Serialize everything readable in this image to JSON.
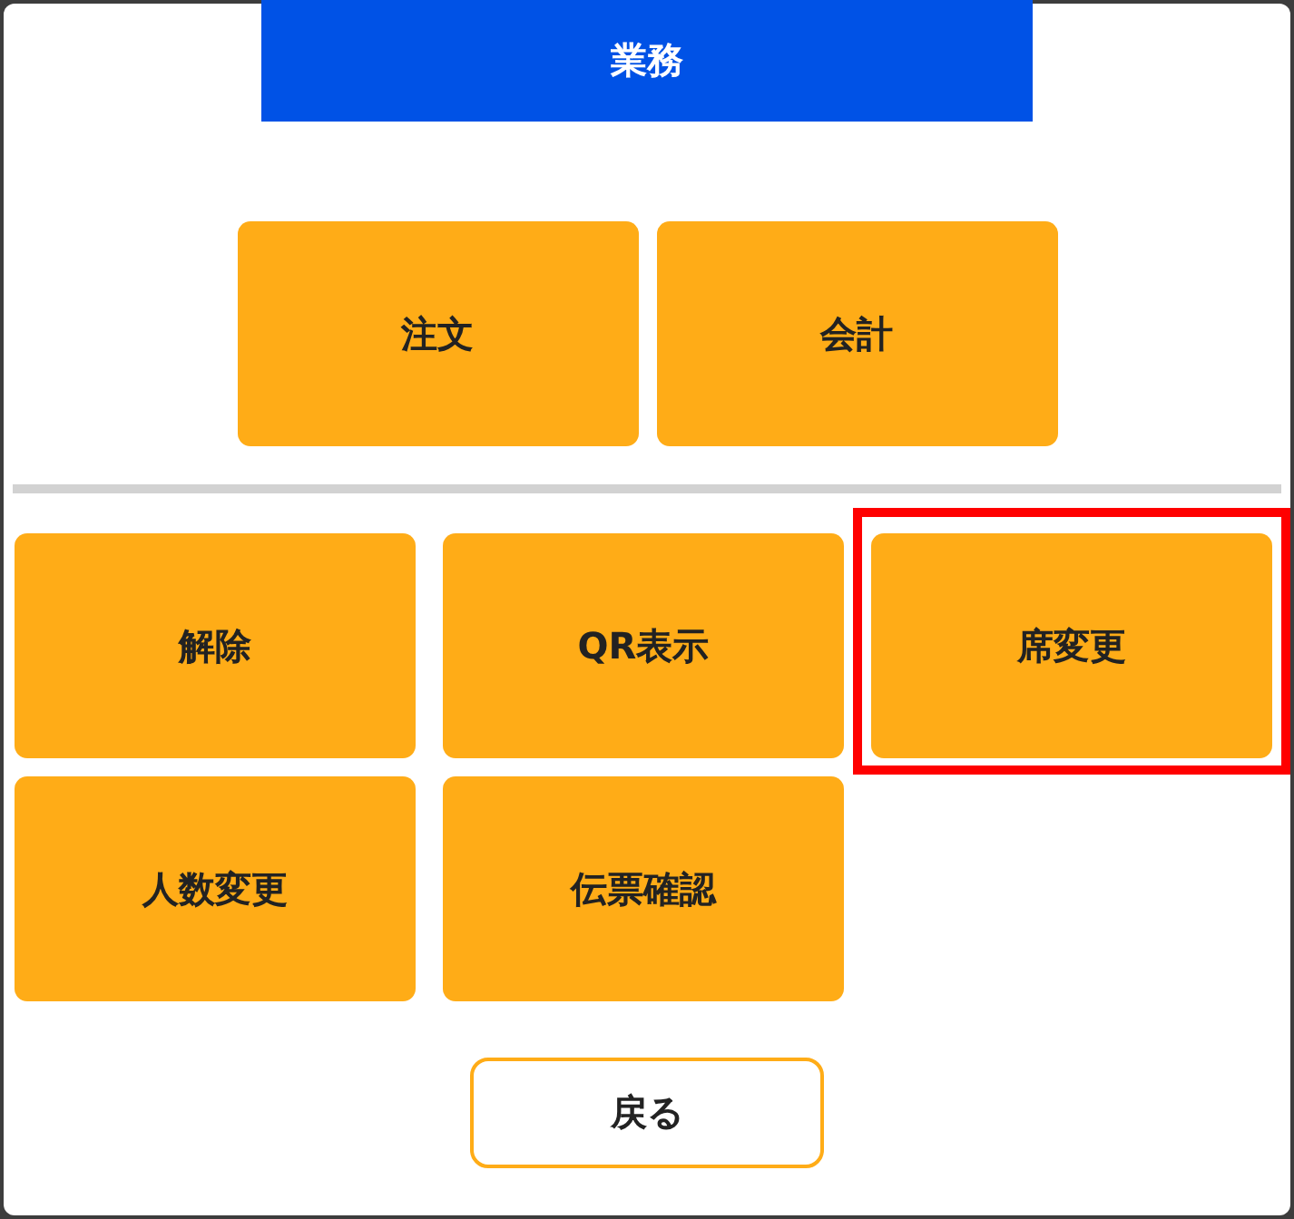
{
  "dialog": {
    "title": "業務"
  },
  "primary_actions": [
    {
      "label": "注文"
    },
    {
      "label": "会計"
    }
  ],
  "actions": [
    {
      "label": "解除",
      "highlighted": false
    },
    {
      "label": "QR表示",
      "highlighted": false
    },
    {
      "label": "席変更",
      "highlighted": true
    },
    {
      "label": "人数変更",
      "highlighted": false
    },
    {
      "label": "伝票確認",
      "highlighted": false
    }
  ],
  "back_button": {
    "label": "戻る"
  }
}
